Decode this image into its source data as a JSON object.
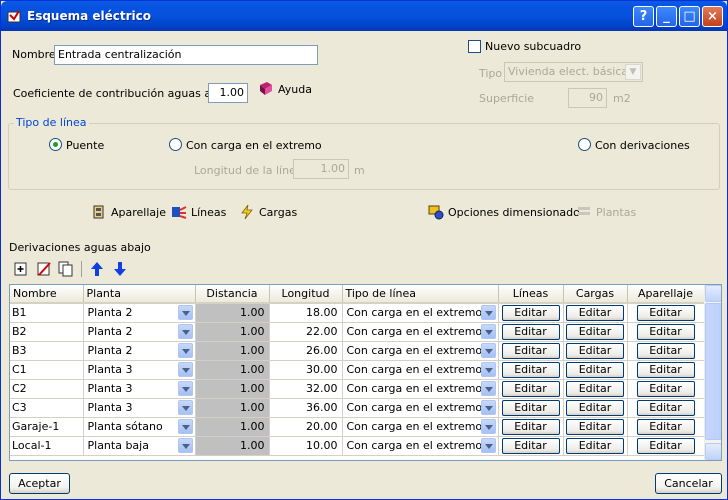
{
  "window": {
    "title": "Esquema eléctrico"
  },
  "form": {
    "nombre_label": "Nombre",
    "nombre_value": "Entrada centralización",
    "coef_label": "Coeficiente de contribución aguas arriba",
    "coef_value": "1.00",
    "ayuda_label": "Ayuda",
    "nuevo_subcuadro_label": "Nuevo subcuadro",
    "tipo_label": "Tipo",
    "tipo_value": "Vivienda elect. básica",
    "superficie_label": "Superficie",
    "superficie_value": "90",
    "superficie_unit": "m2"
  },
  "tipo_linea": {
    "title": "Tipo de línea",
    "options": {
      "puente": "Puente",
      "carga_extremo": "Con carga en el extremo",
      "derivaciones": "Con derivaciones"
    },
    "selected": "puente",
    "longitud_label": "Longitud de la línea",
    "longitud_value": "1.00",
    "longitud_unit": "m"
  },
  "toolbar": {
    "aparellaje": "Aparellaje",
    "lineas": "Líneas",
    "cargas": "Cargas",
    "opciones": "Opciones dimensionado",
    "plantas": "Plantas"
  },
  "derivaciones": {
    "title": "Derivaciones aguas abajo",
    "columns": [
      "Nombre",
      "Planta",
      "Distancia",
      "Longitud",
      "Tipo de línea",
      "Líneas",
      "Cargas",
      "Aparellaje"
    ],
    "edit_label": "Editar",
    "rows": [
      {
        "nombre": "B1",
        "planta": "Planta 2",
        "distancia": "1.00",
        "longitud": "18.00",
        "tipo": "Con carga en el extremo"
      },
      {
        "nombre": "B2",
        "planta": "Planta 2",
        "distancia": "1.00",
        "longitud": "22.00",
        "tipo": "Con carga en el extremo"
      },
      {
        "nombre": "B3",
        "planta": "Planta 2",
        "distancia": "1.00",
        "longitud": "26.00",
        "tipo": "Con carga en el extremo"
      },
      {
        "nombre": "C1",
        "planta": "Planta 3",
        "distancia": "1.00",
        "longitud": "30.00",
        "tipo": "Con carga en el extremo"
      },
      {
        "nombre": "C2",
        "planta": "Planta 3",
        "distancia": "1.00",
        "longitud": "32.00",
        "tipo": "Con carga en el extremo"
      },
      {
        "nombre": "C3",
        "planta": "Planta 3",
        "distancia": "1.00",
        "longitud": "36.00",
        "tipo": "Con carga en el extremo"
      },
      {
        "nombre": "Garaje-1",
        "planta": "Planta sótano",
        "distancia": "1.00",
        "longitud": "20.00",
        "tipo": "Con carga en el extremo"
      },
      {
        "nombre": "Local-1",
        "planta": "Planta baja",
        "distancia": "1.00",
        "longitud": "10.00",
        "tipo": "Con carga en el extremo"
      }
    ]
  },
  "buttons": {
    "aceptar": "Aceptar",
    "cancelar": "Cancelar"
  }
}
